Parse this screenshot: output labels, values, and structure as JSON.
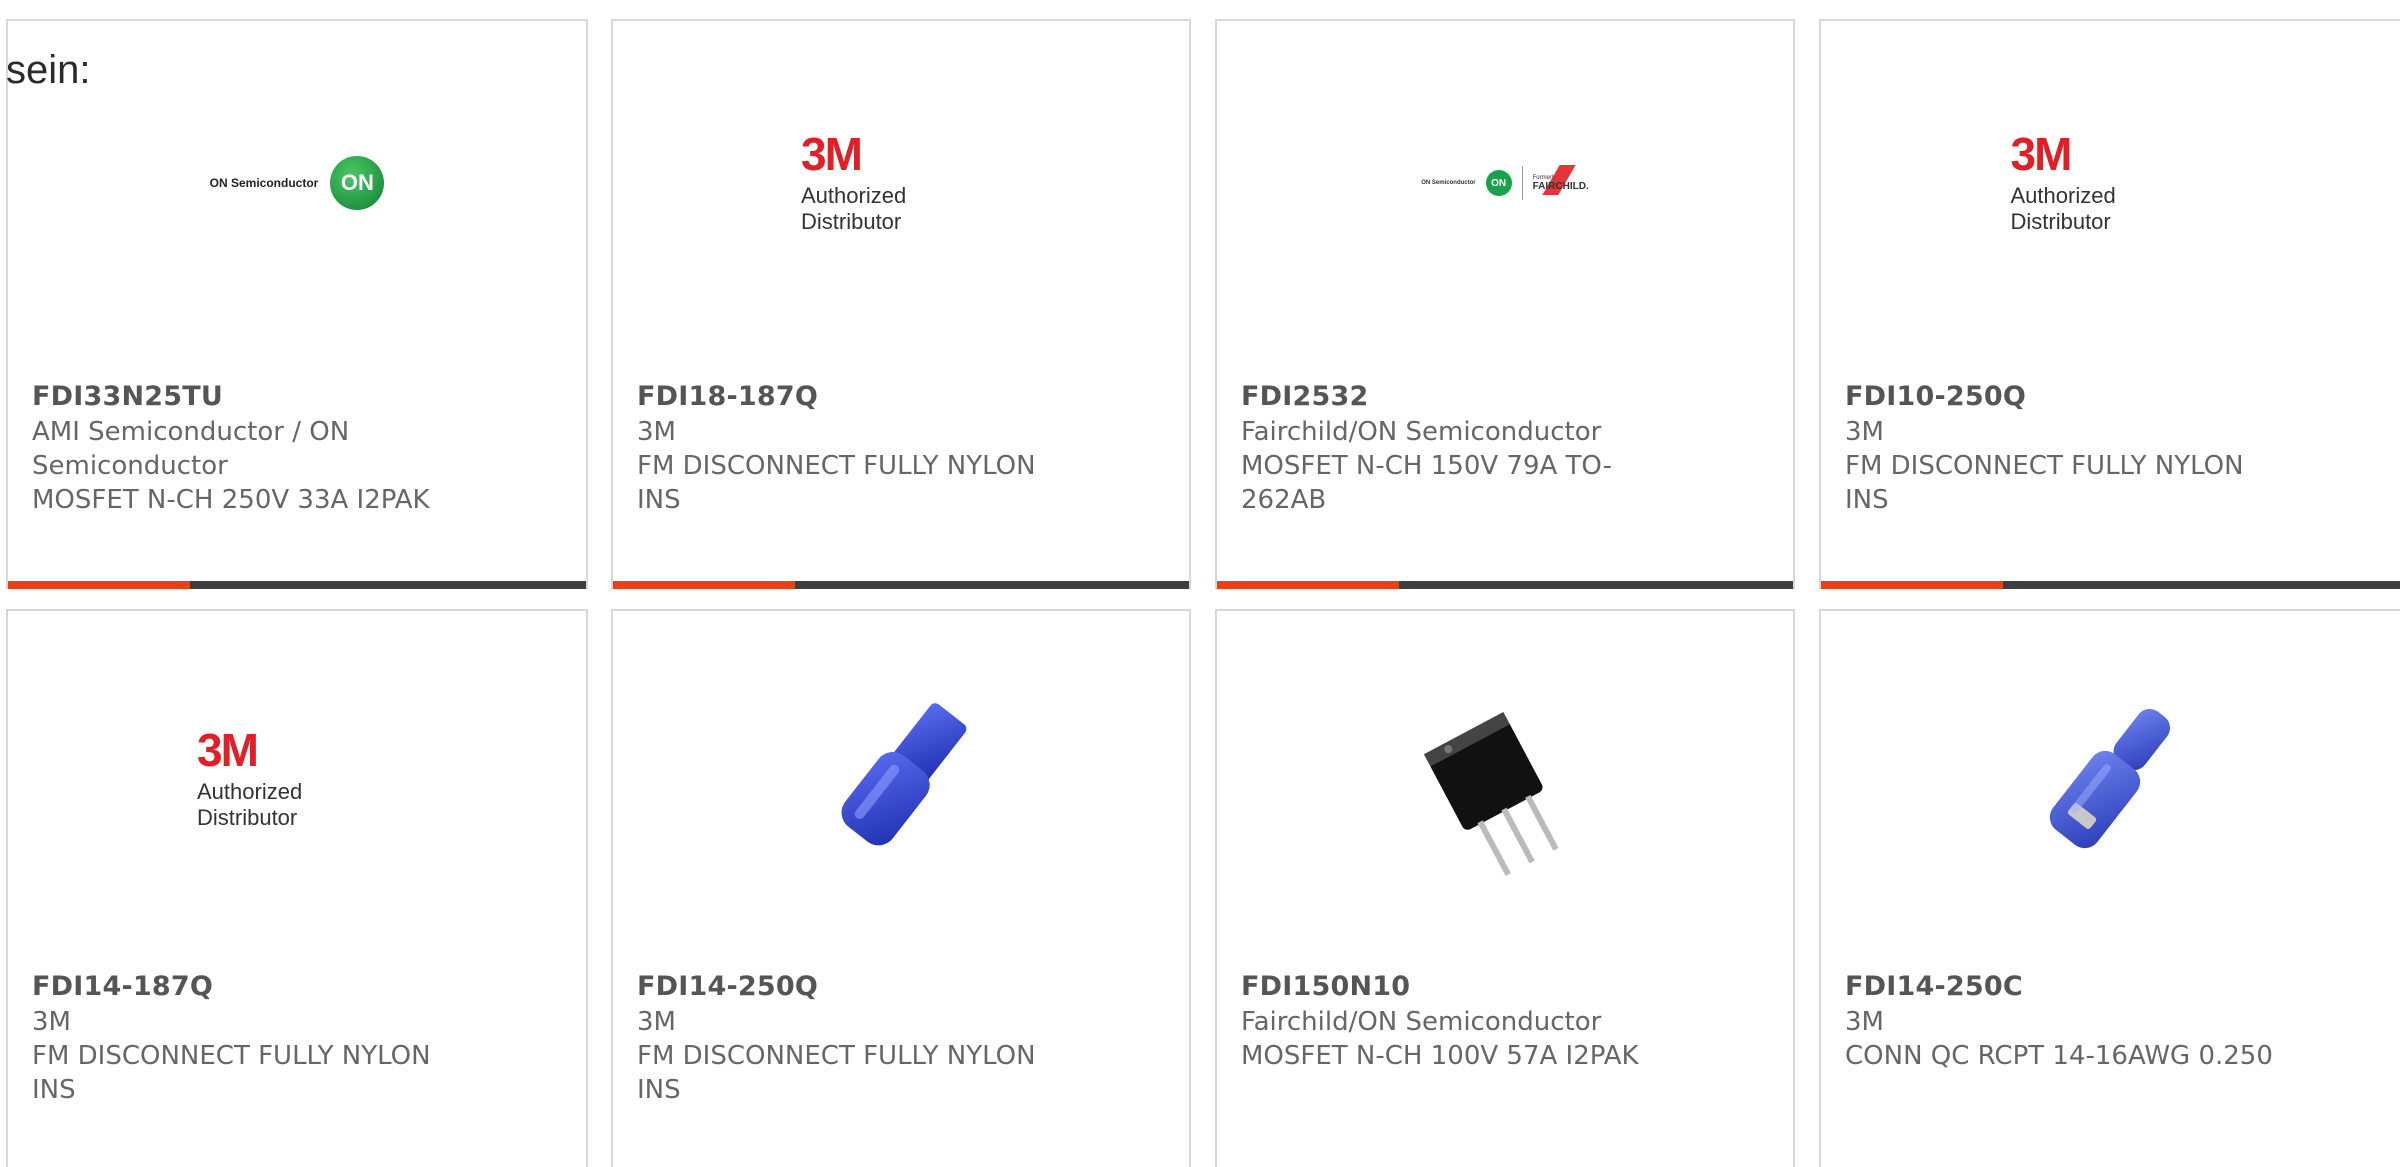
{
  "intro_text": "sein:",
  "colors": {
    "accent": "#e84118",
    "bar": "#3d3d3d",
    "brand_3m": "#e21f26",
    "on_green": "#19a24a"
  },
  "cards": [
    {
      "part": "FDI33N25TU",
      "manufacturer": "AMI Semiconductor / ON Semiconductor",
      "description": "MOSFET N-CH 250V 33A I2PAK",
      "image": "on-semiconductor-logo",
      "logo_text": "ON Semiconductor",
      "logo_mark": "ON"
    },
    {
      "part": "FDI18-187Q",
      "manufacturer": "3M",
      "description": "FM DISCONNECT FULLY NYLON INS",
      "image": "3m-logo",
      "logo_mark": "3M",
      "logo_text": "Authorized Distributor"
    },
    {
      "part": "FDI2532",
      "manufacturer": "Fairchild/ON Semiconductor",
      "description": "MOSFET N-CH 150V 79A TO-262AB",
      "image": "on-fairchild-logo",
      "logo_text": "ON Semiconductor",
      "logo_mark": "ON",
      "logo_sub": "Formerly",
      "logo_fc": "FAIRCHILD."
    },
    {
      "part": "FDI10-250Q",
      "manufacturer": "3M",
      "description": "FM DISCONNECT FULLY NYLON INS",
      "image": "3m-logo",
      "logo_mark": "3M",
      "logo_text": "Authorized Distributor"
    },
    {
      "part": "FDI14-187Q",
      "manufacturer": "3M",
      "description": "FM DISCONNECT FULLY NYLON INS",
      "image": "3m-logo",
      "logo_mark": "3M",
      "logo_text": "Authorized Distributor"
    },
    {
      "part": "FDI14-250Q",
      "manufacturer": "3M",
      "description": "FM DISCONNECT FULLY NYLON INS",
      "image": "blue-connector-photo"
    },
    {
      "part": "FDI150N10",
      "manufacturer": "Fairchild/ON Semiconductor",
      "description": "MOSFET N-CH 100V 57A I2PAK",
      "image": "mosfet-package-photo"
    },
    {
      "part": "FDI14-250C",
      "manufacturer": "3M",
      "description": "CONN QC RCPT 14-16AWG 0.250",
      "image": "blue-receptacle-photo"
    }
  ]
}
